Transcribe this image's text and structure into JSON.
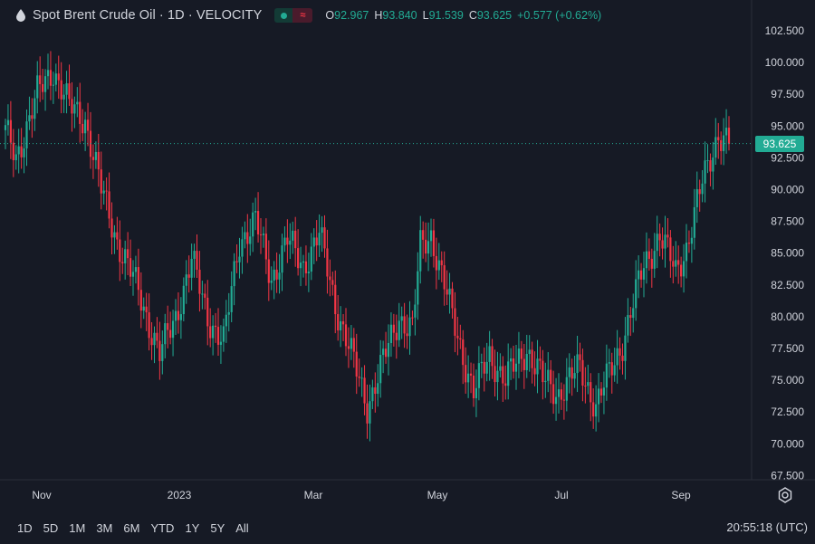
{
  "header": {
    "title": "Spot Brent Crude Oil · 1D · VELOCITY",
    "ohlc": [
      {
        "key": "O",
        "value": "92.967"
      },
      {
        "key": "H",
        "value": "93.840"
      },
      {
        "key": "L",
        "value": "91.539"
      },
      {
        "key": "C",
        "value": "93.625"
      },
      {
        "key": "",
        "value": "+0.577 (+0.62%)"
      }
    ],
    "icons": [
      "drop-icon",
      "status-dot-icon",
      "wave-icon"
    ]
  },
  "last_price": "93.625",
  "ranges": [
    "1D",
    "5D",
    "1M",
    "3M",
    "6M",
    "YTD",
    "1Y",
    "5Y",
    "All"
  ],
  "clock": "20:55:18 (UTC)",
  "colors": {
    "up": "#22ab94",
    "down": "#f23645",
    "bg": "#161a25",
    "text": "#d1d4dc"
  },
  "chart_data": {
    "type": "candlestick",
    "y_ticks": [
      "102.500",
      "100.000",
      "97.500",
      "95.000",
      "92.500",
      "90.000",
      "87.500",
      "85.000",
      "82.500",
      "80.000",
      "77.500",
      "75.000",
      "72.500",
      "70.000",
      "67.500"
    ],
    "x_ticks": [
      "Nov",
      "2023",
      "Mar",
      "May",
      "Jul",
      "Sep"
    ],
    "ylim": [
      67.5,
      102.5
    ],
    "anchor_closes": [
      [
        94.5,
        0
      ],
      [
        92.5,
        4
      ],
      [
        97.5,
        12
      ],
      [
        99.5,
        18
      ],
      [
        96.5,
        24
      ],
      [
        95.5,
        30
      ],
      [
        90,
        36
      ],
      [
        86,
        42
      ],
      [
        82,
        50
      ],
      [
        77,
        58
      ],
      [
        80,
        64
      ],
      [
        84.5,
        70
      ],
      [
        80,
        76
      ],
      [
        78,
        82
      ],
      [
        86,
        88
      ],
      [
        87.5,
        94
      ],
      [
        83,
        100
      ],
      [
        86,
        106
      ],
      [
        84,
        112
      ],
      [
        86.5,
        118
      ],
      [
        81,
        124
      ],
      [
        77,
        130
      ],
      [
        73,
        136
      ],
      [
        76.5,
        142
      ],
      [
        80,
        148
      ],
      [
        79,
        153
      ],
      [
        85.5,
        156
      ],
      [
        86.5,
        160
      ],
      [
        80,
        168
      ],
      [
        74,
        176
      ],
      [
        77,
        182
      ],
      [
        75,
        188
      ],
      [
        77.5,
        196
      ],
      [
        75,
        202
      ],
      [
        74,
        208
      ],
      [
        76,
        216
      ],
      [
        73,
        222
      ],
      [
        78,
        232
      ],
      [
        84,
        240
      ],
      [
        86.5,
        246
      ],
      [
        83.5,
        252
      ],
      [
        85.5,
        256
      ],
      [
        90.5,
        262
      ],
      [
        94.5,
        268
      ],
      [
        93.6,
        272
      ]
    ]
  }
}
